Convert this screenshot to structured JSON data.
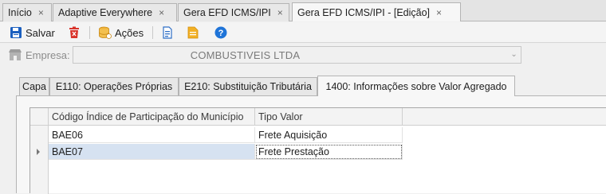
{
  "doc_tabs": [
    {
      "label": "Início",
      "close": "×"
    },
    {
      "label": "Adaptive Everywhere",
      "close": "×"
    },
    {
      "label": "Gera EFD ICMS/IPI",
      "close": "×"
    },
    {
      "label": "Gera EFD ICMS/IPI - [Edição]",
      "close": "×",
      "active": true
    }
  ],
  "toolbar": {
    "save_label": "Salvar",
    "actions_label": "Ações",
    "colors": {
      "save": "#1b5fbf",
      "delete": "#d9332a",
      "actions": "#e8a220",
      "help": "#1f74d8"
    }
  },
  "empresa": {
    "label": "Empresa:",
    "value": "COMBUSTIVEIS LTDA",
    "dropdown_glyph": "⌄"
  },
  "inner_tabs": [
    {
      "label": "Capa"
    },
    {
      "label": "E110: Operações Próprias"
    },
    {
      "label": "E210: Substituição Tributária"
    },
    {
      "label": "1400: Informações sobre Valor Agregado",
      "active": true
    }
  ],
  "grid": {
    "columns": [
      "Código Índice de Participação do Município",
      "Tipo Valor"
    ],
    "rows": [
      {
        "code": "BAE06",
        "tipo": "Frete Aquisição",
        "selected": false
      },
      {
        "code": "BAE07",
        "tipo": "Frete Prestação",
        "selected": true
      }
    ],
    "selection_color": "#d6e2f1"
  }
}
